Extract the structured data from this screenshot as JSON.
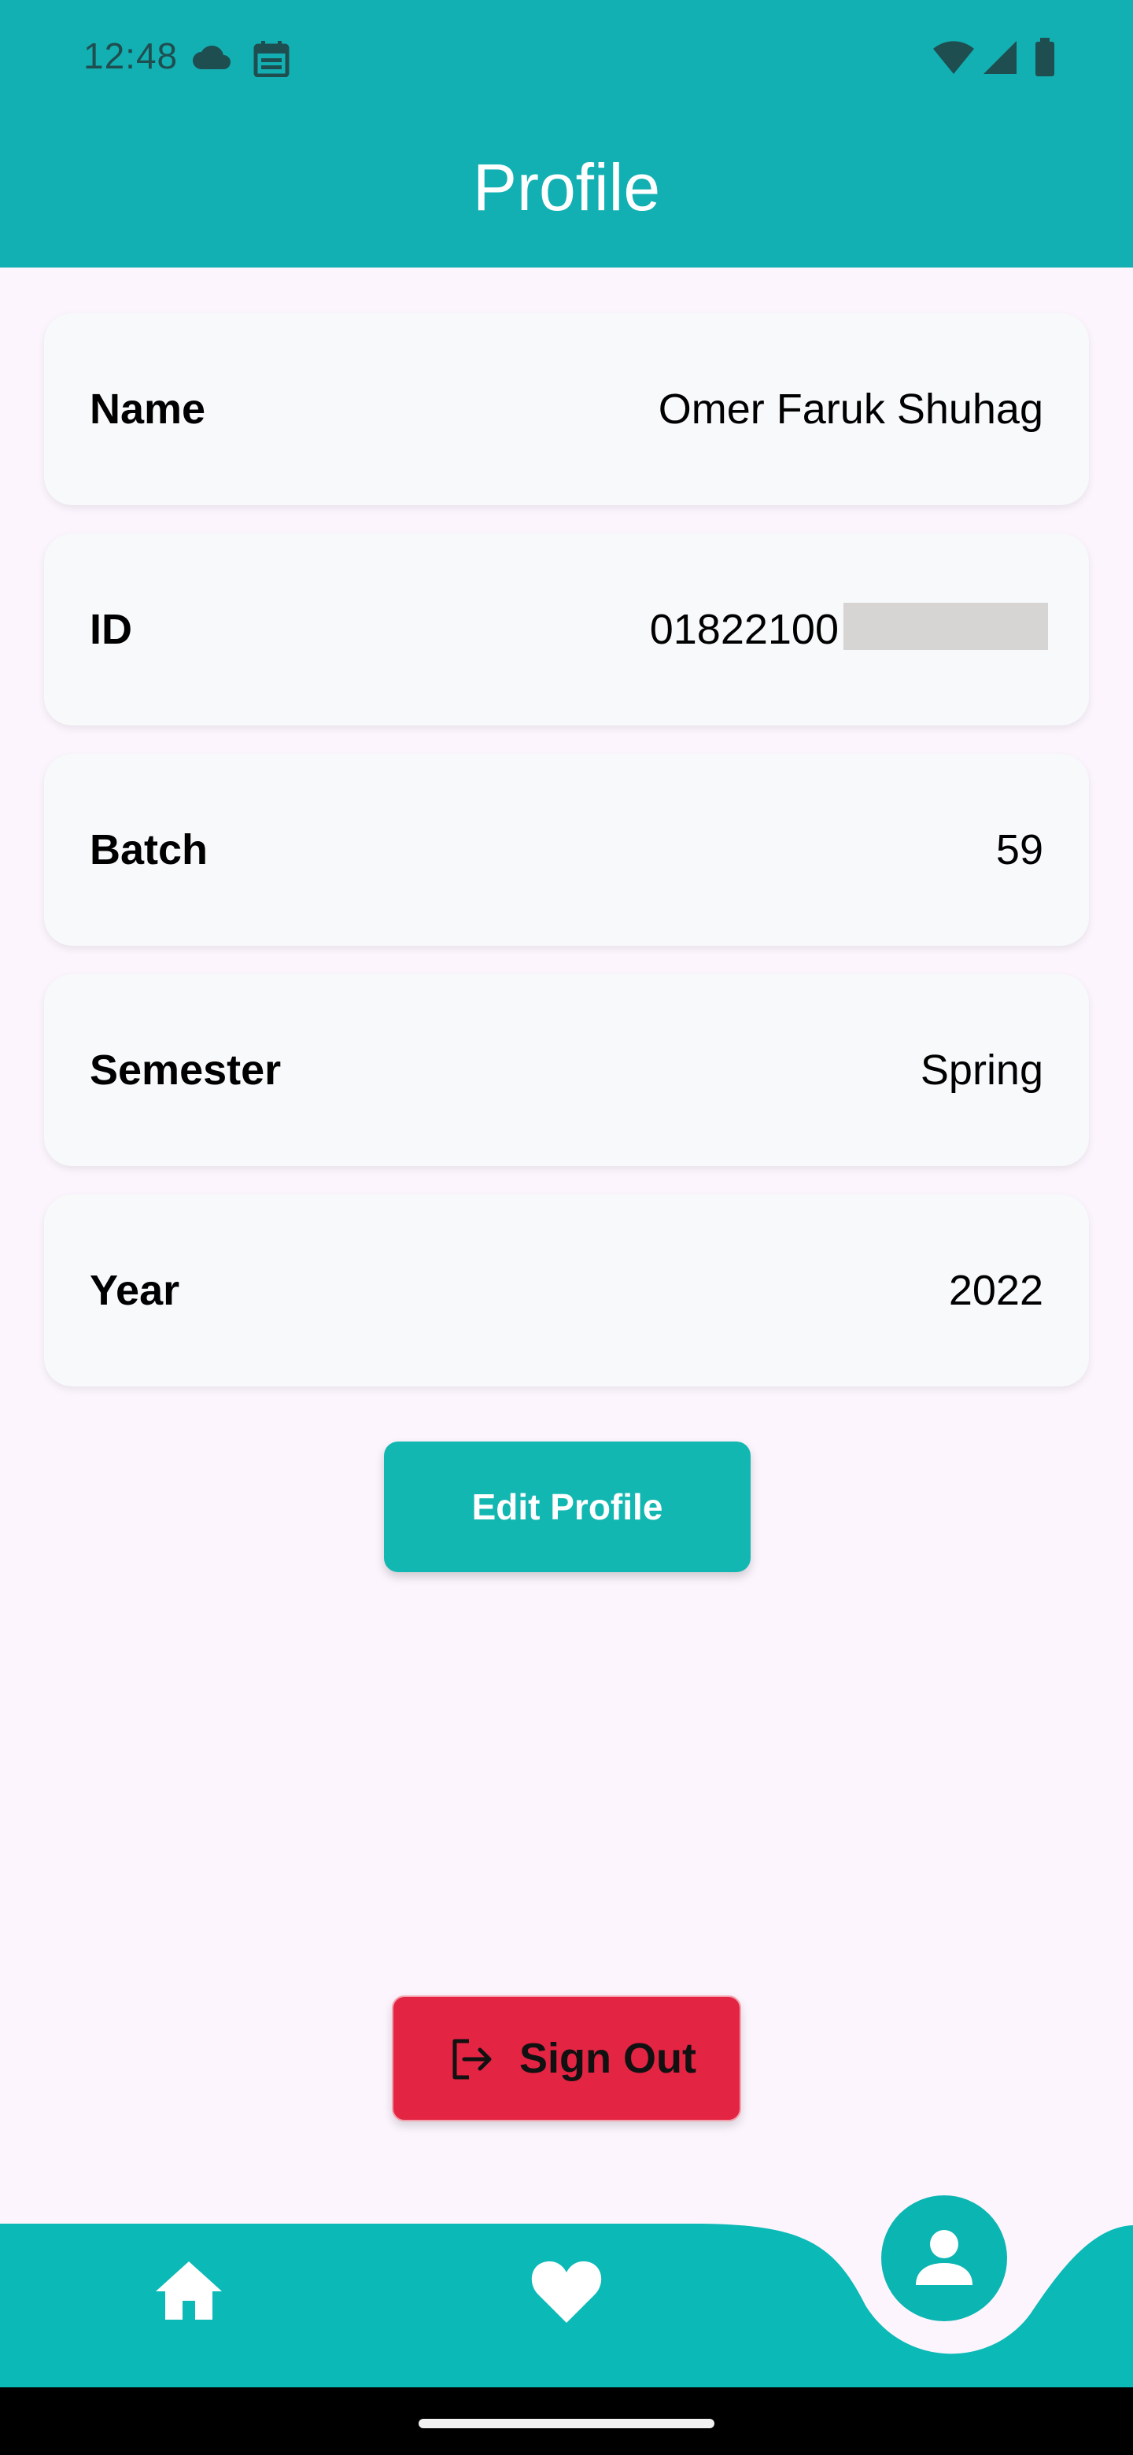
{
  "status_bar": {
    "time": "12:48",
    "icons": [
      "cloud-icon",
      "calendar-icon",
      "wifi-icon",
      "signal-icon",
      "battery-icon"
    ]
  },
  "header": {
    "title": "Profile"
  },
  "profile": {
    "name": {
      "label": "Name",
      "value": "Omer Faruk Shuhag"
    },
    "id": {
      "label": "ID",
      "value": "01822100"
    },
    "batch": {
      "label": "Batch",
      "value": "59"
    },
    "semester": {
      "label": "Semester",
      "value": "Spring"
    },
    "year": {
      "label": "Year",
      "value": "2022"
    }
  },
  "actions": {
    "edit_label": "Edit Profile",
    "signout_label": "Sign Out"
  },
  "bottom_nav": {
    "items": [
      "home-icon",
      "heart-icon",
      "person-icon"
    ],
    "active": "person-icon"
  },
  "colors": {
    "primary": "#13b0b3",
    "danger": "#e32443",
    "background": "#fcf5fd",
    "card": "#f7f9fb"
  }
}
